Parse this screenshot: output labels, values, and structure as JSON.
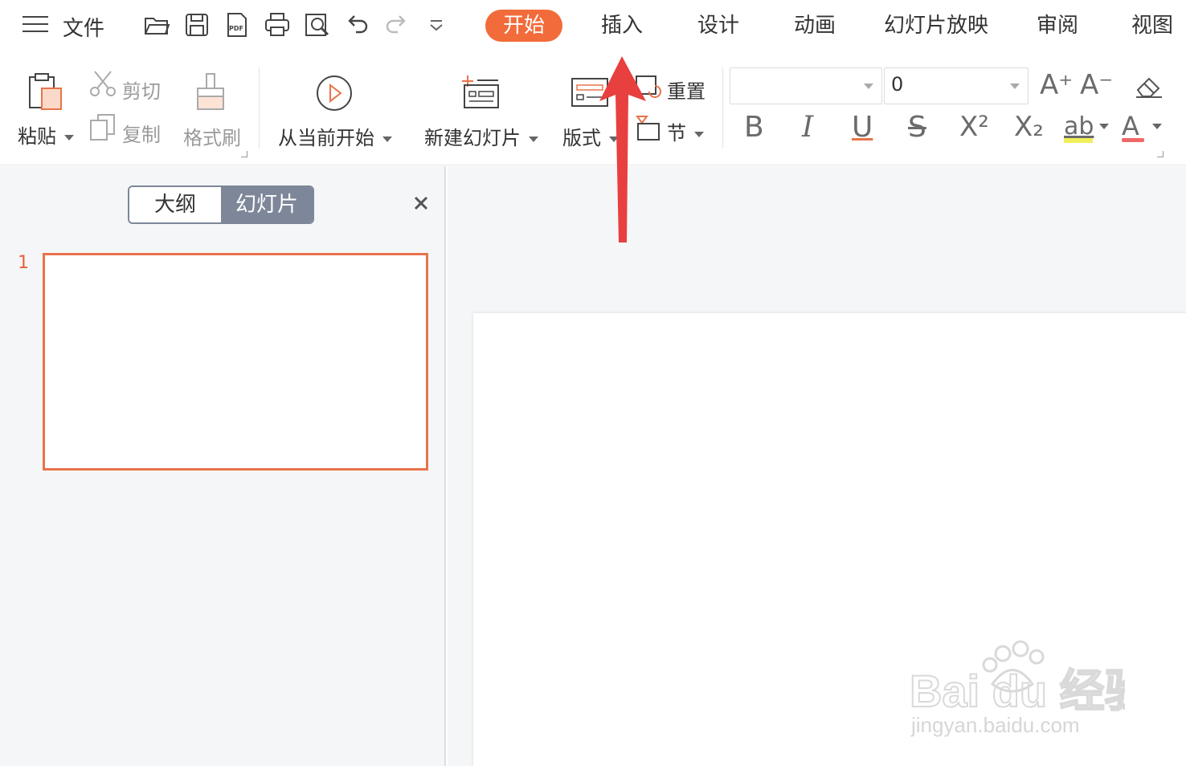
{
  "menu": {
    "file_label": "文件",
    "tabs": [
      {
        "label": "开始",
        "active": true
      },
      {
        "label": "插入",
        "active": false
      },
      {
        "label": "设计",
        "active": false
      },
      {
        "label": "动画",
        "active": false
      },
      {
        "label": "幻灯片放映",
        "active": false
      },
      {
        "label": "审阅",
        "active": false
      },
      {
        "label": "视图",
        "active": false
      }
    ],
    "quick_access_icons": [
      "open-folder-icon",
      "save-icon",
      "export-pdf-icon",
      "print-icon",
      "print-preview-icon",
      "undo-icon",
      "redo-icon",
      "customize-dropdown-icon"
    ]
  },
  "ribbon": {
    "paste_label": "粘贴",
    "cut_label": "剪切",
    "copy_label": "复制",
    "format_painter_label": "格式刷",
    "play_from_current_label": "从当前开始",
    "new_slide_label": "新建幻灯片",
    "layout_label": "版式",
    "reset_label": "重置",
    "section_label": "节",
    "font_name_value": "",
    "font_size_value": "0",
    "increase_font_label": "A⁺",
    "decrease_font_label": "A⁻",
    "bold_label": "B",
    "italic_label": "I",
    "underline_label": "U",
    "strike_label": "S",
    "superscript_label": "X²",
    "subscript_label": "X₂",
    "highlight_label": "ab",
    "font_color_label": "A"
  },
  "left_panel": {
    "outline_tab": "大纲",
    "slides_tab": "幻灯片",
    "slides": [
      {
        "number": "1"
      }
    ]
  },
  "watermark": {
    "brand": "Bai du 经验",
    "url": "jingyan.baidu.com"
  },
  "colors": {
    "accent": "#f26b3a",
    "arrow": "#e8403f",
    "segment": "#7d8799"
  }
}
